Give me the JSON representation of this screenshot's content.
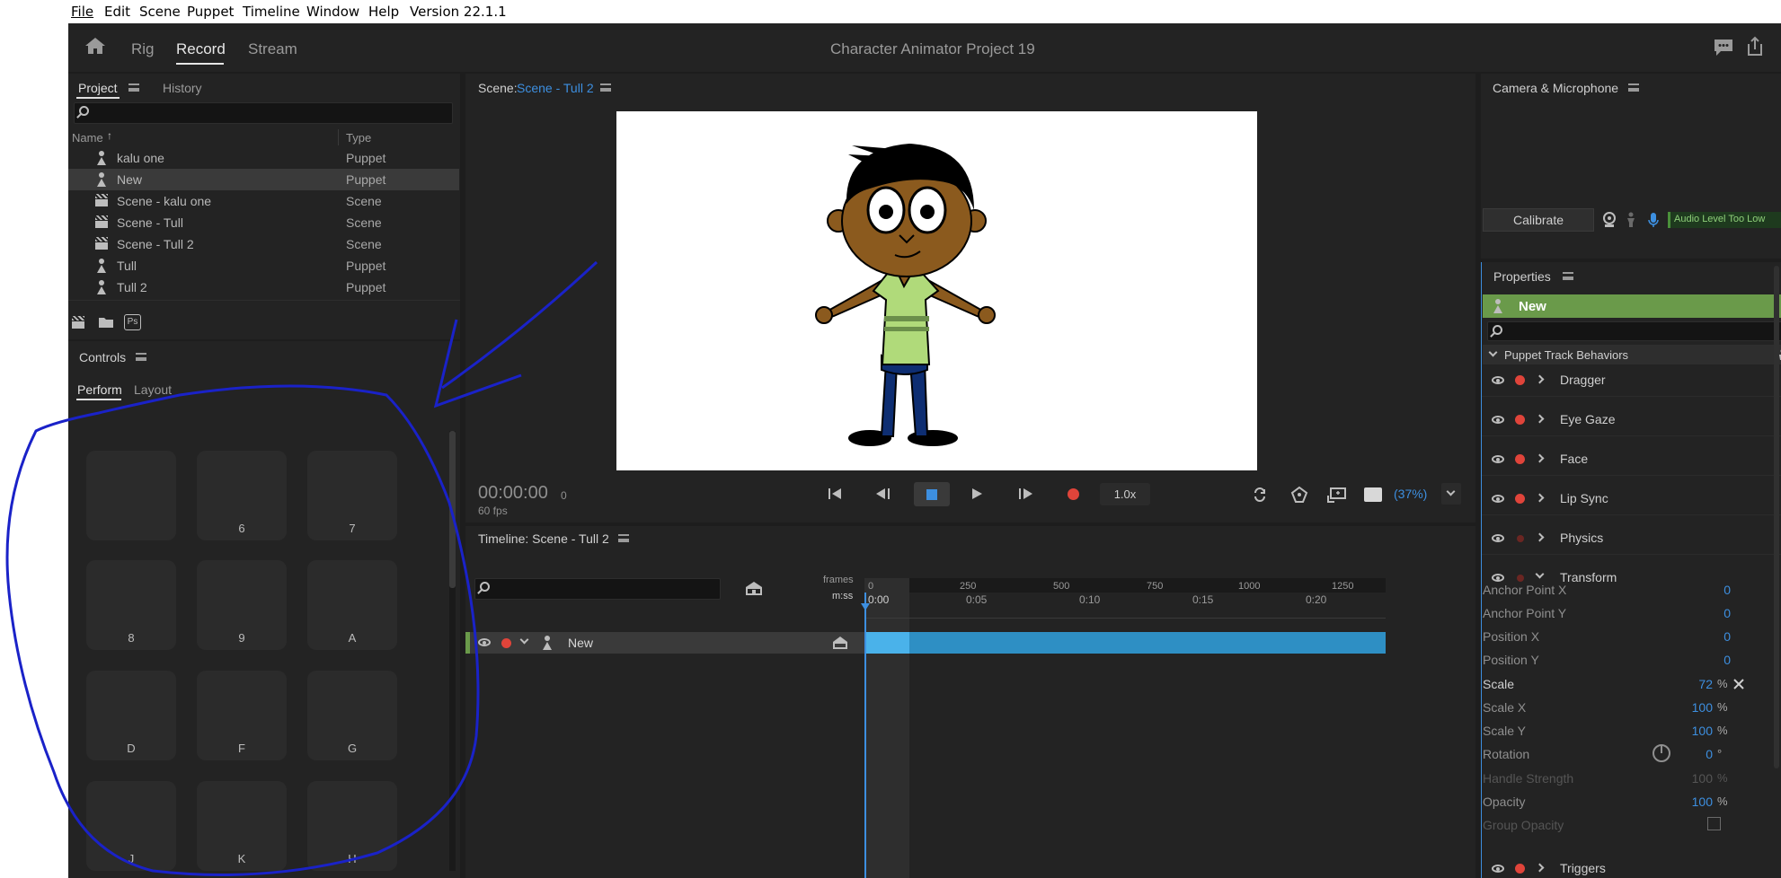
{
  "menubar": {
    "items": [
      "File",
      "Edit",
      "Scene",
      "Puppet",
      "Timeline",
      "Window",
      "Help"
    ],
    "version": "Version 22.1.1"
  },
  "topbar": {
    "tabs": [
      "Rig",
      "Record",
      "Stream"
    ],
    "active": "Record",
    "project_title": "Character Animator Project 19"
  },
  "project_panel": {
    "tabs": [
      "Project",
      "History"
    ],
    "search_placeholder": "",
    "columns": {
      "name": "Name",
      "type": "Type"
    },
    "rows": [
      {
        "name": "kalu one",
        "type": "Puppet",
        "icon": "puppet-icon"
      },
      {
        "name": "New",
        "type": "Puppet",
        "icon": "puppet-icon",
        "selected": true
      },
      {
        "name": "Scene - kalu one",
        "type": "Scene",
        "icon": "scene-icon"
      },
      {
        "name": "Scene - Tull",
        "type": "Scene",
        "icon": "scene-icon"
      },
      {
        "name": "Scene - Tull 2",
        "type": "Scene",
        "icon": "scene-icon"
      },
      {
        "name": "Tull",
        "type": "Puppet",
        "icon": "puppet-icon"
      },
      {
        "name": "Tull 2",
        "type": "Puppet",
        "icon": "puppet-icon"
      }
    ],
    "footer_ps": "Ps"
  },
  "controls_panel": {
    "title": "Controls",
    "tabs": [
      "Perform",
      "Layout"
    ],
    "pads": [
      "",
      "6",
      "7",
      "8",
      "9",
      "A",
      "D",
      "F",
      "G",
      "J",
      "K",
      "H"
    ]
  },
  "scene_panel": {
    "label": "Scene:",
    "scene_name": "Scene - Tull 2",
    "timecode": "00:00:00",
    "frame": "0",
    "fps": "60 fps",
    "speed": "1.0x",
    "zoom": "(37%)"
  },
  "timeline_panel": {
    "title": "Timeline: Scene - Tull 2",
    "frames_label": "frames",
    "mss_label": "m:ss",
    "frame_ticks": [
      "0",
      "250",
      "500",
      "750",
      "1000",
      "1250"
    ],
    "time_ticks": [
      "0:00",
      "0:05",
      "0:10",
      "0:15",
      "0:20"
    ],
    "track_name": "New"
  },
  "camera_panel": {
    "title": "Camera & Microphone",
    "calibrate": "Calibrate",
    "audio_status": "Audio Level Too Low"
  },
  "properties_panel": {
    "title": "Properties",
    "puppet": "New",
    "section": "Puppet Track Behaviors",
    "behaviors": [
      "Dragger",
      "Eye Gaze",
      "Face",
      "Lip Sync",
      "Physics",
      "Transform"
    ],
    "last_behavior": "Triggers",
    "transform": {
      "anchor_x": {
        "label": "Anchor Point X",
        "value": "0"
      },
      "anchor_y": {
        "label": "Anchor Point Y",
        "value": "0"
      },
      "pos_x": {
        "label": "Position X",
        "value": "0"
      },
      "pos_y": {
        "label": "Position Y",
        "value": "0"
      },
      "scale": {
        "label": "Scale",
        "value": "72",
        "unit": "%"
      },
      "scale_x": {
        "label": "Scale X",
        "value": "100",
        "unit": "%"
      },
      "scale_y": {
        "label": "Scale Y",
        "value": "100",
        "unit": "%"
      },
      "rotation": {
        "label": "Rotation",
        "value": "0",
        "unit": "°"
      },
      "handle": {
        "label": "Handle Strength",
        "value": "100",
        "unit": "%"
      },
      "opacity": {
        "label": "Opacity",
        "value": "100",
        "unit": "%"
      },
      "group_opacity": {
        "label": "Group Opacity"
      }
    }
  },
  "colors": {
    "accent": "#3d8fe0",
    "puppet_bar": "#6a9a4a",
    "track_bar": "#2e8fc4",
    "record": "#e0443a",
    "annotation": "#1a22c8"
  }
}
